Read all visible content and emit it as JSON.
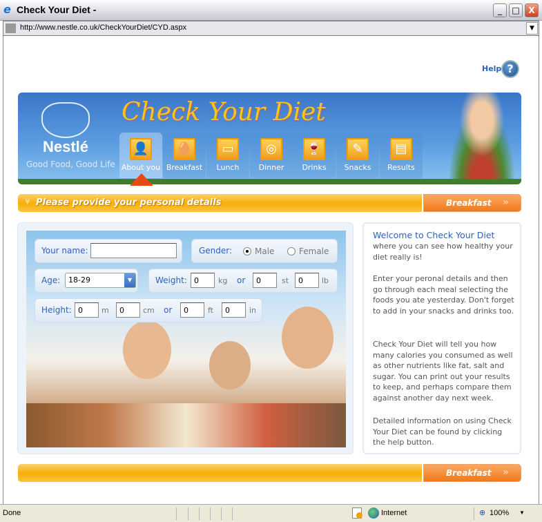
{
  "window": {
    "title": "Check Your Diet -",
    "url": "http://www.nestle.co.uk/CheckYourDiet/CYD.aspx"
  },
  "help": {
    "label": "Help",
    "icon": "question-icon"
  },
  "banner": {
    "brand": "Nestlé",
    "slogan": "Good Food, Good Life",
    "title": "Check Your Diet",
    "tabs": [
      {
        "label": "About you",
        "icon": "person-icon",
        "active": true
      },
      {
        "label": "Breakfast",
        "icon": "egg-icon"
      },
      {
        "label": "Lunch",
        "icon": "lunchbox-icon"
      },
      {
        "label": "Dinner",
        "icon": "plate-icon"
      },
      {
        "label": "Drinks",
        "icon": "glasses-icon"
      },
      {
        "label": "Snacks",
        "icon": "snack-icon"
      },
      {
        "label": "Results",
        "icon": "notepad-icon"
      }
    ]
  },
  "instruction": "Please provide your personal details",
  "next_button": "Breakfast",
  "form": {
    "name_label": "Your name:",
    "name_value": "",
    "gender_label": "Gender:",
    "male": "Male",
    "female": "Female",
    "gender_selected": "Male",
    "age_label": "Age:",
    "age_value": "18-29",
    "weight_label": "Weight:",
    "kg": "0",
    "kg_unit": "kg",
    "or": "or",
    "st": "0",
    "st_unit": "st",
    "lb": "0",
    "lb_unit": "lb",
    "height_label": "Height:",
    "m": "0",
    "m_unit": "m",
    "cm": "0",
    "cm_unit": "cm",
    "ft": "0",
    "ft_unit": "ft",
    "in": "0",
    "in_unit": "in"
  },
  "welcome": {
    "heading": "Welcome to Check Your Diet",
    "p1": "where you can see how healthy your diet really is!",
    "p2": "Enter your peronal details and then go through each meal selecting the foods you ate yesterday.  Don't forget to add in your snacks and drinks too.",
    "p3": "Check Your Diet will tell you how many calories you consumed as well as other nutrients like fat, salt and sugar. You can print out your results to keep, and perhaps compare them against another day next week.",
    "p4": "Detailed information on using Check Your Diet can be found by clicking the help button."
  },
  "status": {
    "text": "Done",
    "zone": "Internet",
    "zoom": "100%"
  }
}
